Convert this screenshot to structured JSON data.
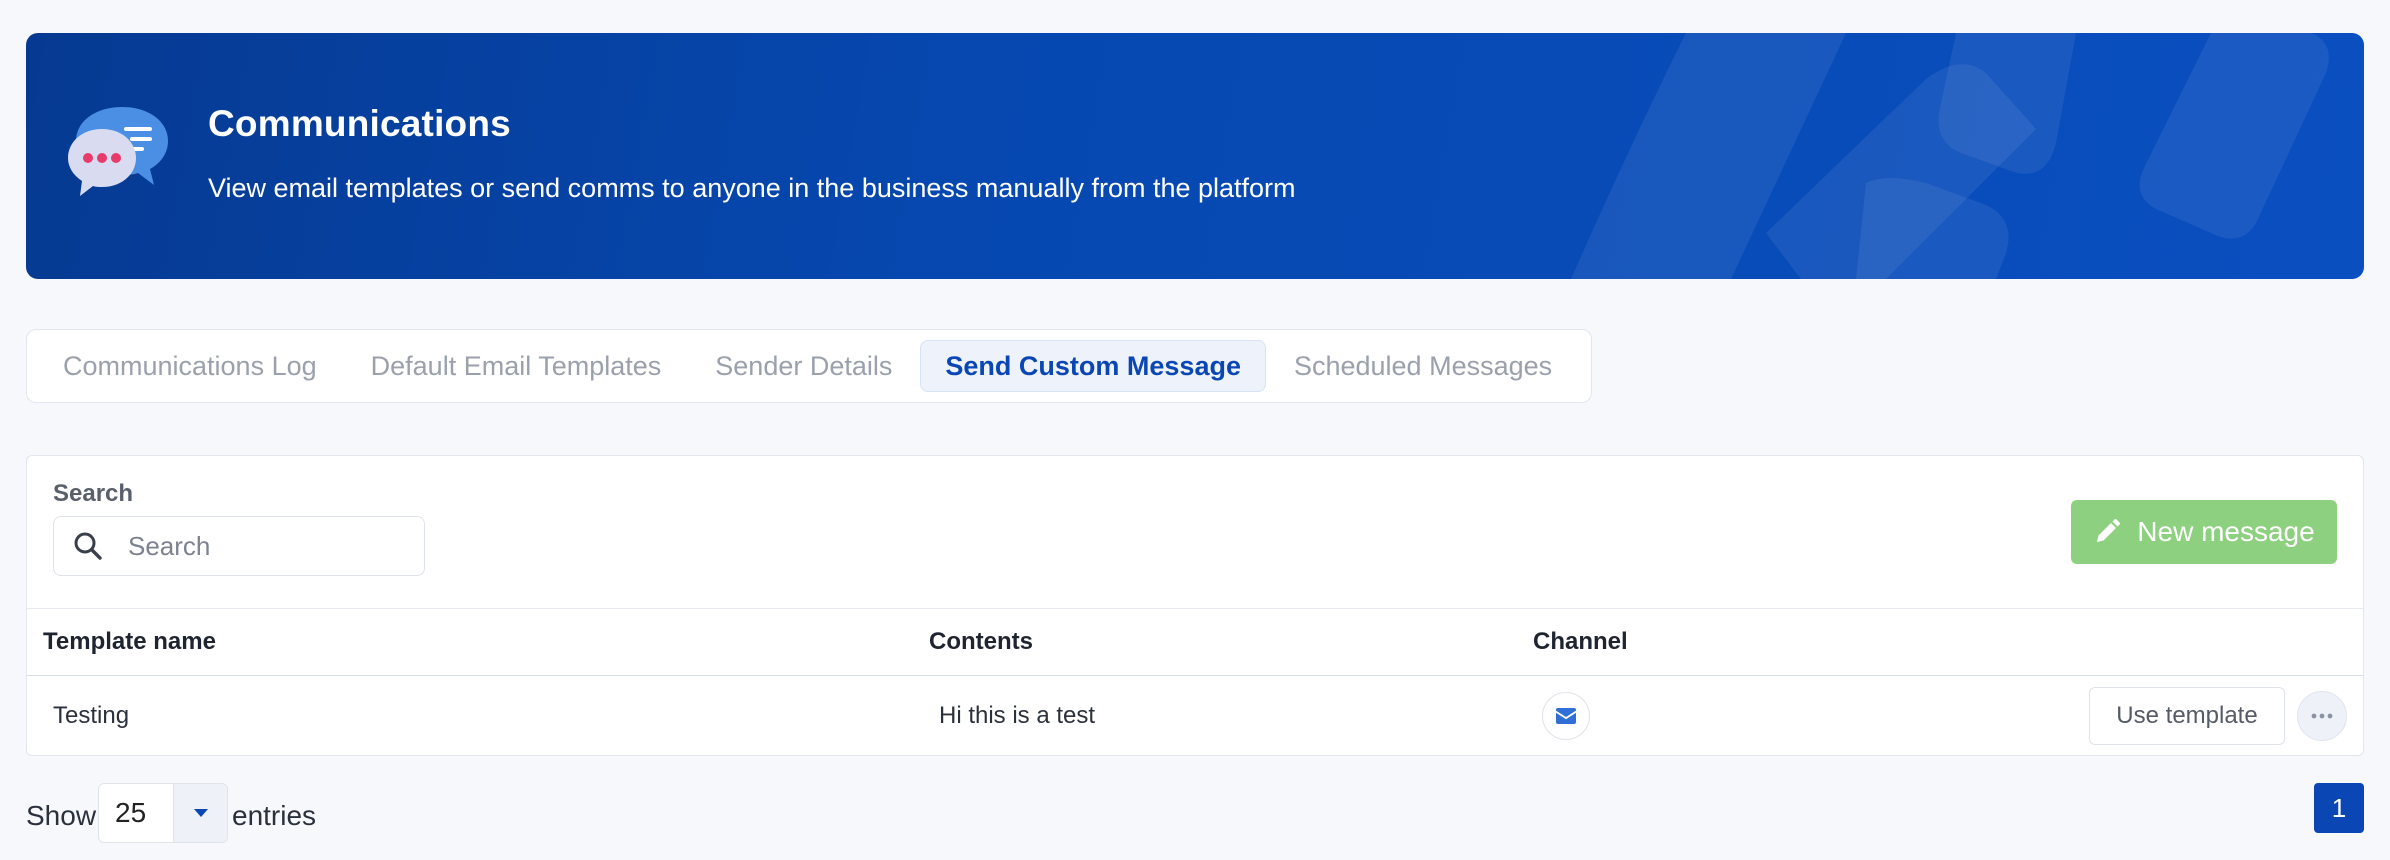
{
  "banner": {
    "title": "Communications",
    "subtitle": "View email templates or send comms to anyone in the business manually from the platform",
    "icon": "chat-bubbles-icon"
  },
  "tabs": [
    {
      "label": "Communications Log",
      "active": false
    },
    {
      "label": "Default Email Templates",
      "active": false
    },
    {
      "label": "Sender Details",
      "active": false
    },
    {
      "label": "Send Custom Message",
      "active": true
    },
    {
      "label": "Scheduled Messages",
      "active": false
    }
  ],
  "search": {
    "label": "Search",
    "placeholder": "Search",
    "value": ""
  },
  "toolbar": {
    "new_message_label": "New message"
  },
  "table": {
    "columns": [
      "Template name",
      "Contents",
      "Channel"
    ],
    "rows": [
      {
        "template_name": "Testing",
        "contents": "Hi this is a test",
        "channel": "email-icon",
        "action_label": "Use template"
      }
    ]
  },
  "footer": {
    "show_label": "Show",
    "page_size": "25",
    "entries_label": "entries",
    "current_page": "1"
  },
  "colors": {
    "banner": "#0648b0",
    "accent": "#0b47b4",
    "new_button": "#8dd07f"
  }
}
